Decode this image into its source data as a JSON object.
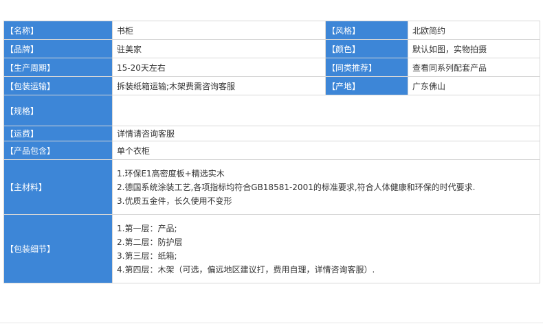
{
  "rows": [
    {
      "l1": "【名称】",
      "v1": "书柜",
      "l2": "【风格】",
      "v2": "北欧简约"
    },
    {
      "l1": "【品牌】",
      "v1": "驻美家",
      "l2": "【颜色】",
      "v2": "默认如图，实物拍摄"
    },
    {
      "l1": "【生产周期】",
      "v1": "15-20天左右",
      "l2": "【同类推荐】",
      "v2": "查看同系列配套产品"
    },
    {
      "l1": "【包装运输】",
      "v1": "拆装纸箱运输;木架费需咨询客服",
      "l2": "【产地】",
      "v2": "广东佛山"
    }
  ],
  "spec": {
    "label": "【规格】",
    "value": ""
  },
  "shipping": {
    "label": "【运费】",
    "value": "详情请咨询客服"
  },
  "includes": {
    "label": "【产品包含】",
    "value": "单个衣柜"
  },
  "material": {
    "label": "【主材料】",
    "lines": [
      "1.环保E1高密度板+精选实木",
      "2.德国系统涂装工艺,各项指标均符合GB18581-2001的标准要求,符合人体健康和环保的时代要求.",
      "3.优质五金件，长久使用不变形"
    ]
  },
  "packing": {
    "label": "【包装细节】",
    "lines": [
      "1.第一层：产品;",
      "2.第二层：防护层",
      "3.第三层：纸箱;",
      "4.第四层：木架（可选，偏远地区建议打，费用自理，详情咨询客服）."
    ]
  }
}
